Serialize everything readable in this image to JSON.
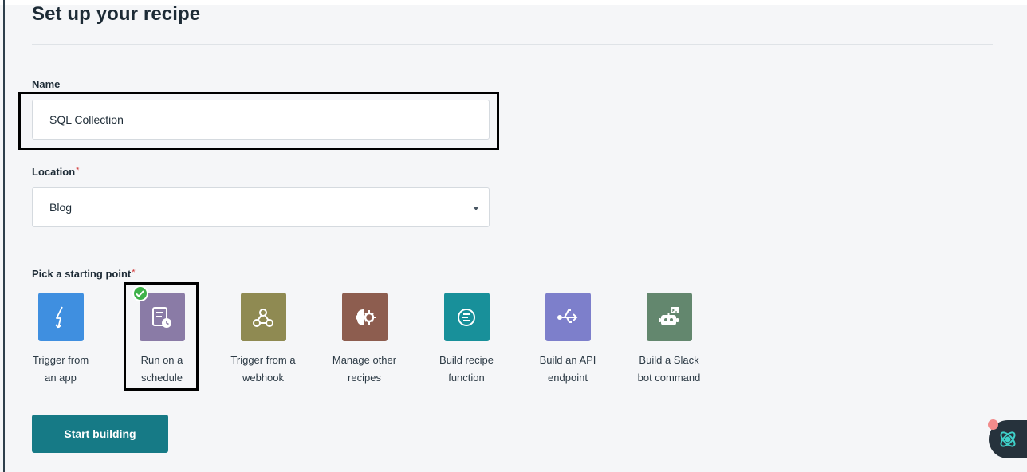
{
  "page": {
    "title": "Set up your recipe"
  },
  "form": {
    "name_label": "Name",
    "name_value": "SQL Collection",
    "location_label": "Location",
    "location_value": "Blog",
    "required_mark": "*",
    "starting_point_label": "Pick a starting point"
  },
  "starting_points": [
    {
      "label": "Trigger from\nan app",
      "icon": "lightning-icon",
      "color": "#3f8fe0",
      "selected": false
    },
    {
      "label": "Run on a\nschedule",
      "icon": "schedule-icon",
      "color": "#8a7ba6",
      "selected": true
    },
    {
      "label": "Trigger from a\nwebhook",
      "icon": "webhook-icon",
      "color": "#8f8a52",
      "selected": false
    },
    {
      "label": "Manage other\nrecipes",
      "icon": "brain-icon",
      "color": "#8d5d4f",
      "selected": false
    },
    {
      "label": "Build recipe\nfunction",
      "icon": "function-icon",
      "color": "#18909a",
      "selected": false
    },
    {
      "label": "Build an API\nendpoint",
      "icon": "api-icon",
      "color": "#7d7fcb",
      "selected": false
    },
    {
      "label": "Build a Slack\nbot command",
      "icon": "bot-icon",
      "color": "#63876e",
      "selected": false
    }
  ],
  "actions": {
    "start_building": "Start building"
  },
  "colors": {
    "accent": "#167a86",
    "check": "#3fb24a",
    "required": "#d33a3a"
  }
}
